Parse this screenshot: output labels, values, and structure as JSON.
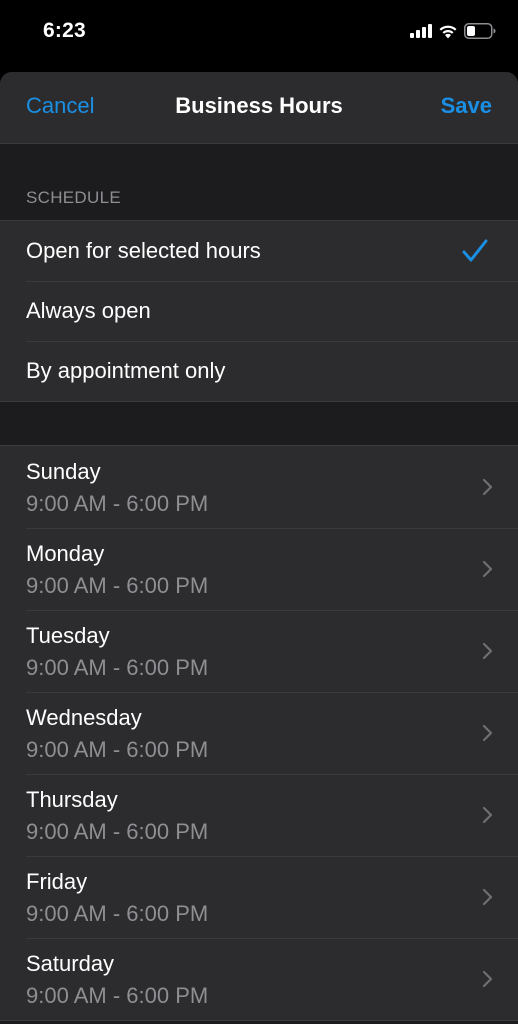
{
  "status_bar": {
    "time": "6:23",
    "icons": [
      "cellular-signal-icon",
      "wifi-icon",
      "battery-icon"
    ]
  },
  "nav": {
    "cancel_label": "Cancel",
    "title": "Business Hours",
    "save_label": "Save"
  },
  "schedule": {
    "header": "SCHEDULE",
    "options": [
      {
        "label": "Open for selected hours",
        "selected": true
      },
      {
        "label": "Always open",
        "selected": false
      },
      {
        "label": "By appointment only",
        "selected": false
      }
    ]
  },
  "days": [
    {
      "name": "Sunday",
      "hours": "9:00 AM - 6:00 PM"
    },
    {
      "name": "Monday",
      "hours": "9:00 AM - 6:00 PM"
    },
    {
      "name": "Tuesday",
      "hours": "9:00 AM - 6:00 PM"
    },
    {
      "name": "Wednesday",
      "hours": "9:00 AM - 6:00 PM"
    },
    {
      "name": "Thursday",
      "hours": "9:00 AM - 6:00 PM"
    },
    {
      "name": "Friday",
      "hours": "9:00 AM - 6:00 PM"
    },
    {
      "name": "Saturday",
      "hours": "9:00 AM - 6:00 PM"
    }
  ],
  "colors": {
    "accent": "#1a8fe3",
    "background": "#000000",
    "sheet": "#1c1c1e",
    "cell": "#2c2c2e",
    "secondary_text": "#8e8e93",
    "separator": "#3a3a3c"
  }
}
